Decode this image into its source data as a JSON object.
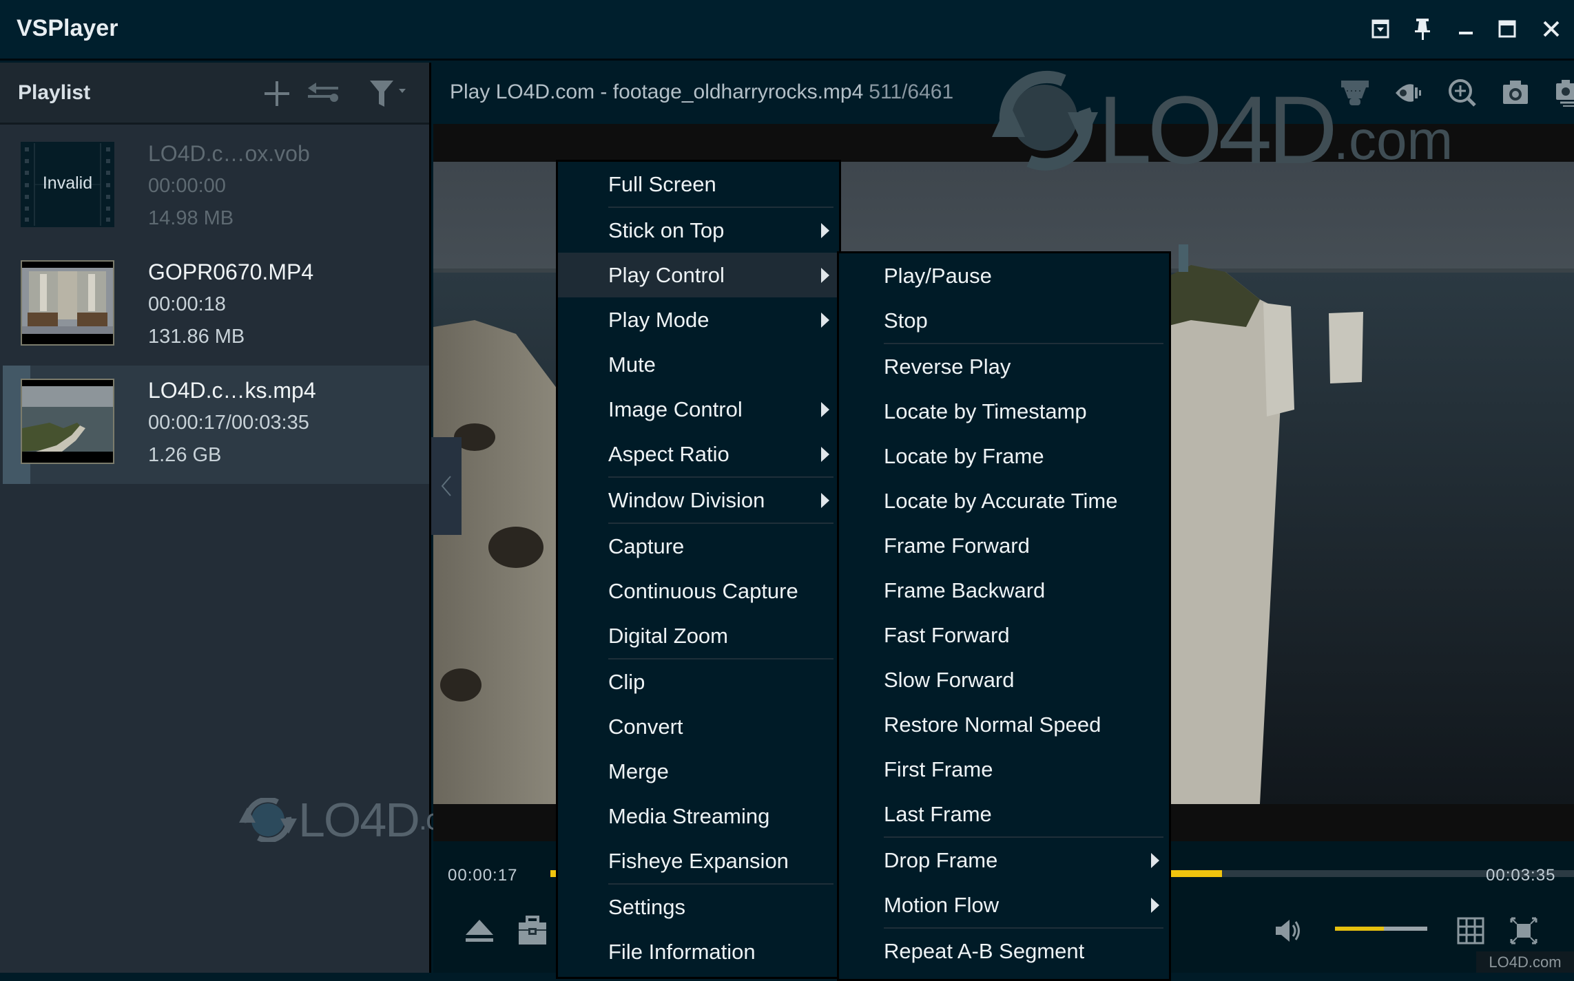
{
  "window": {
    "title": "VSPlayer",
    "controls": [
      "window-menu",
      "pin",
      "minimize",
      "maximize",
      "close"
    ]
  },
  "playlist": {
    "title": "Playlist",
    "toolbar_icons": [
      "add-icon",
      "swap-order-icon",
      "filter-icon"
    ],
    "items": [
      {
        "name": "LO4D.c…ox.vob",
        "duration": "00:00:00",
        "size": "14.98 MB",
        "thumbnail_label": "Invalid",
        "state": "invalid"
      },
      {
        "name": "GOPR0670.MP4",
        "duration": "00:00:18",
        "size": "131.86 MB",
        "state": "normal"
      },
      {
        "name": "LO4D.c…ks.mp4",
        "duration": "00:00:17/00:03:35",
        "size": "1.26 GB",
        "state": "selected"
      }
    ],
    "watermark": {
      "brand": "LO4D",
      "suffix": ".com"
    }
  },
  "player": {
    "now_playing": "Play LO4D.com - footage_oldharryrocks.mp4",
    "frame_counter": "511/6461",
    "toolbar_icons": [
      "fisheye-camera-icon",
      "audio-eye-icon",
      "digital-zoom-icon",
      "snapshot-icon",
      "continuous-capture-icon"
    ],
    "watermark": {
      "brand": "LO4D",
      "suffix": ".com"
    },
    "current_time": "00:00:17",
    "total_time": "00:03:35",
    "progress_fraction": 0.079,
    "volume_fraction": 0.53,
    "accent_color": "#f0c40e"
  },
  "context_menu": {
    "items": [
      {
        "label": "Full Screen",
        "submenu": false,
        "sep_after": true
      },
      {
        "label": "Stick on Top",
        "submenu": true,
        "sep_after": false
      },
      {
        "label": "Play Control",
        "submenu": true,
        "sep_after": false,
        "active": true
      },
      {
        "label": "Play Mode",
        "submenu": true,
        "sep_after": false
      },
      {
        "label": "Mute",
        "submenu": false,
        "sep_after": false
      },
      {
        "label": "Image Control",
        "submenu": true,
        "sep_after": false
      },
      {
        "label": "Aspect Ratio",
        "submenu": true,
        "sep_after": true
      },
      {
        "label": "Window Division",
        "submenu": true,
        "sep_after": true
      },
      {
        "label": "Capture",
        "submenu": false,
        "sep_after": false
      },
      {
        "label": "Continuous Capture",
        "submenu": false,
        "sep_after": false
      },
      {
        "label": "Digital Zoom",
        "submenu": false,
        "sep_after": true
      },
      {
        "label": "Clip",
        "submenu": false,
        "sep_after": false
      },
      {
        "label": "Convert",
        "submenu": false,
        "sep_after": false
      },
      {
        "label": "Merge",
        "submenu": false,
        "sep_after": false
      },
      {
        "label": "Media Streaming",
        "submenu": false,
        "sep_after": false
      },
      {
        "label": "Fisheye Expansion",
        "submenu": false,
        "sep_after": true
      },
      {
        "label": "Settings",
        "submenu": false,
        "sep_after": false
      },
      {
        "label": "File Information",
        "submenu": false,
        "sep_after": false
      }
    ]
  },
  "play_control_submenu": {
    "items": [
      {
        "label": "Play/Pause",
        "submenu": false,
        "sep_after": false
      },
      {
        "label": "Stop",
        "submenu": false,
        "sep_after": true
      },
      {
        "label": "Reverse Play",
        "submenu": false,
        "sep_after": false
      },
      {
        "label": "Locate by Timestamp",
        "submenu": false,
        "sep_after": false
      },
      {
        "label": "Locate by Frame",
        "submenu": false,
        "sep_after": false
      },
      {
        "label": "Locate by Accurate Time",
        "submenu": false,
        "sep_after": false
      },
      {
        "label": "Frame Forward",
        "submenu": false,
        "sep_after": false
      },
      {
        "label": "Frame Backward",
        "submenu": false,
        "sep_after": false
      },
      {
        "label": "Fast Forward",
        "submenu": false,
        "sep_after": false
      },
      {
        "label": "Slow Forward",
        "submenu": false,
        "sep_after": false
      },
      {
        "label": "Restore Normal Speed",
        "submenu": false,
        "sep_after": false
      },
      {
        "label": "First Frame",
        "submenu": false,
        "sep_after": false
      },
      {
        "label": "Last Frame",
        "submenu": false,
        "sep_after": true
      },
      {
        "label": "Drop Frame",
        "submenu": true,
        "sep_after": false
      },
      {
        "label": "Motion Flow",
        "submenu": true,
        "sep_after": true
      },
      {
        "label": "Repeat A-B Segment",
        "submenu": false,
        "sep_after": false
      }
    ]
  },
  "corner_watermark": "LO4D.com"
}
